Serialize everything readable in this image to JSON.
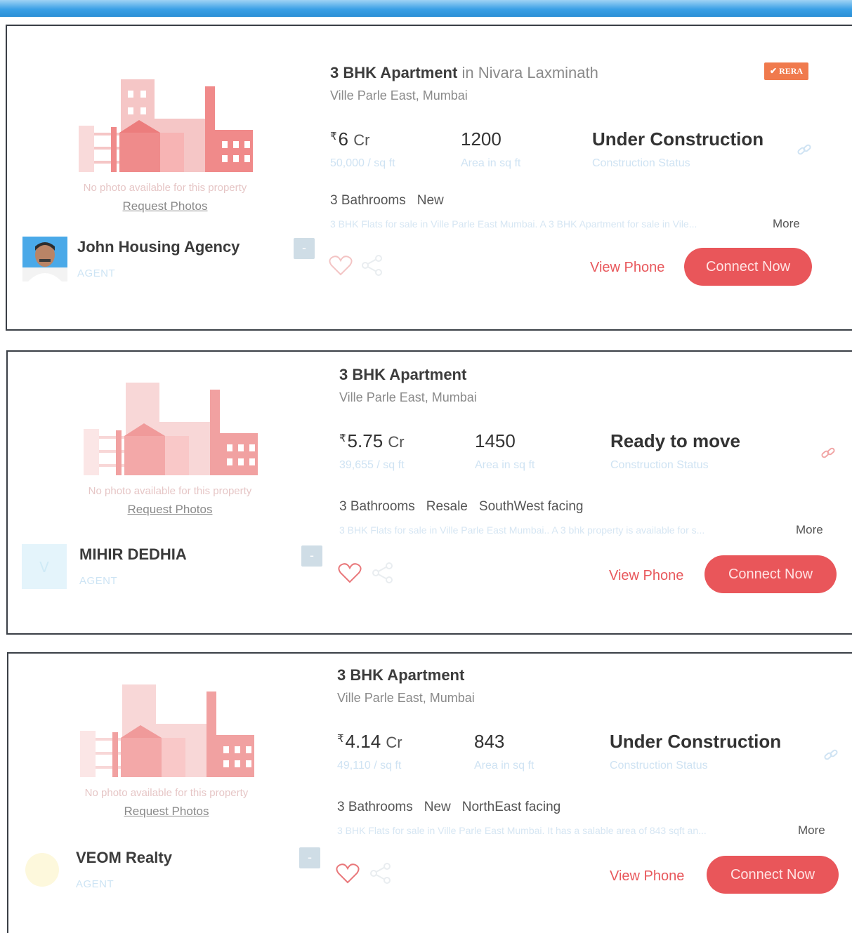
{
  "listings": [
    {
      "title": "3 BHK Apartment",
      "project": "in Nivara Laxminath",
      "locality": "Ville Parle East, Mumbai",
      "rera": "RERA",
      "price_symbol": "₹",
      "price_value": "6",
      "price_unit": "Cr",
      "price_per_sqft": "50,000 / sq ft",
      "area": "1200",
      "area_label": "Area in sq ft",
      "status": "Under Construction",
      "status_label": "Construction Status",
      "chips": [
        "3 Bathrooms",
        "New"
      ],
      "description": "3 BHK Flats for sale in Ville Parle East Mumbai. A 3 BHK Apartment for sale in Vile...",
      "more": "More",
      "view_phone": "View Phone",
      "connect": "Connect Now",
      "no_photo": "No photo available for this property",
      "request_photos": "Request Photos",
      "agent_name": "John Housing Agency",
      "agent_role": "AGENT"
    },
    {
      "title": "3 BHK Apartment",
      "project": "",
      "locality": "Ville Parle East, Mumbai",
      "price_symbol": "₹",
      "price_value": "5.75",
      "price_unit": "Cr",
      "price_per_sqft": "39,655 / sq ft",
      "area": "1450",
      "area_label": "Area in sq ft",
      "status": "Ready to move",
      "status_label": "Construction Status",
      "chips": [
        "3 Bathrooms",
        "Resale",
        "SouthWest facing"
      ],
      "description": "3 BHK Flats for sale in Ville Parle East Mumbai.. A 3 bhk property is available for s...",
      "more": "More",
      "view_phone": "View Phone",
      "connect": "Connect Now",
      "no_photo": "No photo available for this property",
      "request_photos": "Request Photos",
      "agent_name": "MIHIR DEDHIA",
      "agent_role": "AGENT"
    },
    {
      "title": "3 BHK Apartment",
      "project": "",
      "locality": "Ville Parle East, Mumbai",
      "price_symbol": "₹",
      "price_value": "4.14",
      "price_unit": "Cr",
      "price_per_sqft": "49,110 / sq ft",
      "area": "843",
      "area_label": "Area in sq ft",
      "status": "Under Construction",
      "status_label": "Construction Status",
      "chips": [
        "3 Bathrooms",
        "New",
        "NorthEast facing"
      ],
      "description": "3 BHK Flats for sale in Ville Parle East Mumbai. It has a salable area of 843 sqft an...",
      "more": "More",
      "view_phone": "View Phone",
      "connect": "Connect Now",
      "no_photo": "No photo available for this property",
      "request_photos": "Request Photos",
      "agent_name": "VEOM Realty",
      "agent_role": "AGENT"
    }
  ],
  "colors": {
    "accent": "#e9565a",
    "header_blue": "#2b8fd6",
    "rera": "#f07a4d"
  }
}
